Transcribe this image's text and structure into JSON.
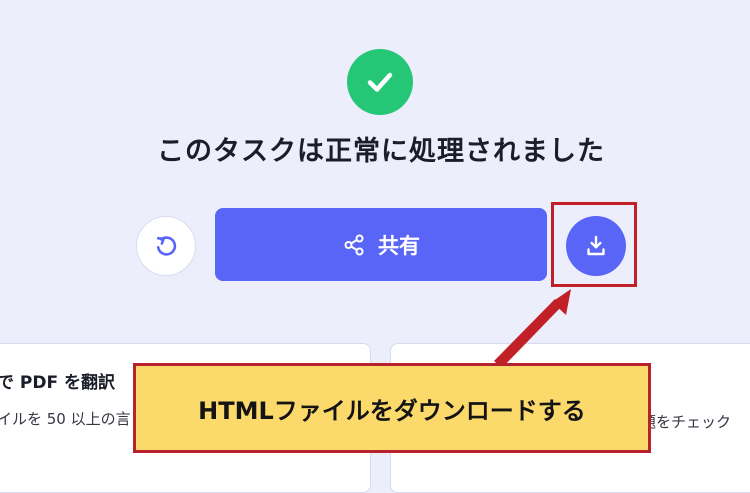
{
  "page": {
    "status_title": "このタスクは正常に処理されました",
    "share_label": "共有"
  },
  "cards": {
    "left": {
      "title": "で PDF を翻訳",
      "description": "イルを 50 以上の言"
    },
    "right": {
      "description": "題をチェック"
    }
  },
  "annotation": {
    "callout_text": "HTMLファイルをダウンロードする"
  },
  "icons": {
    "success": "check-circle-icon",
    "retry": "refresh-icon",
    "share": "share-icon",
    "download": "download-icon"
  },
  "colors": {
    "background": "#eceefb",
    "primary": "#5865f6",
    "success": "#25c776",
    "highlight": "#c02026",
    "callout": "#fcd96b"
  }
}
